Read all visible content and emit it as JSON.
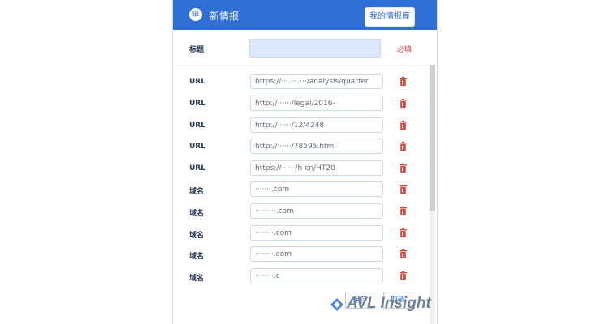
{
  "header": {
    "title": "新情报",
    "library_button": "我的情报库",
    "logo_glyph": "⊞"
  },
  "title_field": {
    "label": "标题",
    "required": "必填",
    "value": ""
  },
  "rows": [
    {
      "label": "URL",
      "value": "https://···.···.···/analysis/quarter"
    },
    {
      "label": "URL",
      "value": "http://······/legal/2016-"
    },
    {
      "label": "URL",
      "value": "http://······/12/4248"
    },
    {
      "label": "URL",
      "value": "http://······/78595.htm"
    },
    {
      "label": "URL",
      "value": "https://······/h-cn/HT20"
    },
    {
      "label": "域名",
      "value": "·······.com"
    },
    {
      "label": "域名",
      "value": "·········.com"
    },
    {
      "label": "域名",
      "value": "········.com"
    },
    {
      "label": "域名",
      "value": "········.com"
    },
    {
      "label": "域名",
      "value": "········.c"
    }
  ],
  "footer": {
    "confirm": "保存",
    "cancel": "取消"
  },
  "watermark": {
    "text": "AVL Insight"
  },
  "colors": {
    "header": "#2f6fd6",
    "required": "#d9463b",
    "trash": "#d9463b"
  }
}
